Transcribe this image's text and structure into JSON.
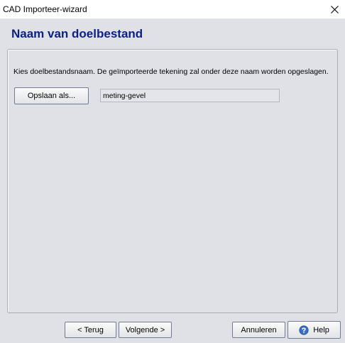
{
  "window": {
    "title": "CAD Importeer-wizard",
    "close_icon": "close-icon"
  },
  "header": {
    "title": "Naam van doelbestand"
  },
  "content": {
    "instruction": "Kies doelbestandsnaam. De geïmporteerde tekening zal onder deze naam worden opgeslagen.",
    "save_as_label": "Opslaan als...",
    "filename_value": "meting-gevel"
  },
  "footer": {
    "back_label": "< Terug",
    "next_label": "Volgende >",
    "cancel_label": "Annuleren",
    "help_label": "Help",
    "help_icon": "help-icon"
  },
  "colors": {
    "title_text": "#0c1f86",
    "background": "#dfe1e6"
  }
}
